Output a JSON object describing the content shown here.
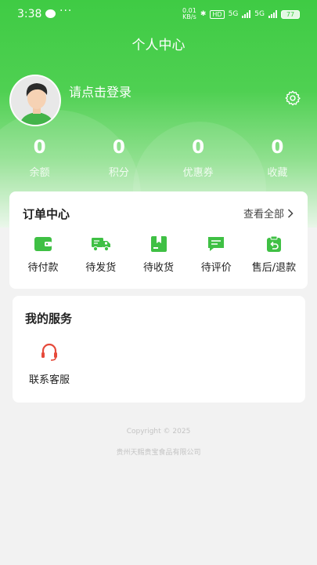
{
  "status_bar": {
    "time": "3:38",
    "dots": "···",
    "net_speed_top": "0.01",
    "net_speed_bottom": "KB/s",
    "hd": "HD",
    "sim1": "5G",
    "sim2": "5G",
    "battery": "77"
  },
  "header": {
    "title": "个人中心"
  },
  "profile": {
    "login_prompt": "请点击登录"
  },
  "stats": [
    {
      "value": "0",
      "label": "余额"
    },
    {
      "value": "0",
      "label": "积分"
    },
    {
      "value": "0",
      "label": "优惠券"
    },
    {
      "value": "0",
      "label": "收藏"
    }
  ],
  "orders": {
    "title": "订单中心",
    "view_all": "查看全部",
    "items": [
      {
        "label": "待付款",
        "icon": "wallet-icon"
      },
      {
        "label": "待发货",
        "icon": "truck-icon"
      },
      {
        "label": "待收货",
        "icon": "package-icon"
      },
      {
        "label": "待评价",
        "icon": "review-icon"
      },
      {
        "label": "售后/退款",
        "icon": "refund-icon"
      }
    ]
  },
  "services": {
    "title": "我的服务",
    "items": [
      {
        "label": "联系客服",
        "icon": "headset-icon"
      }
    ]
  },
  "footer": {
    "copyright": "Copyright © 2025",
    "company": "贵州天赐贵宝食品有限公司"
  },
  "colors": {
    "brand": "#3fcb44",
    "icon_green": "#3fc044",
    "service_red": "#e64a3b"
  }
}
